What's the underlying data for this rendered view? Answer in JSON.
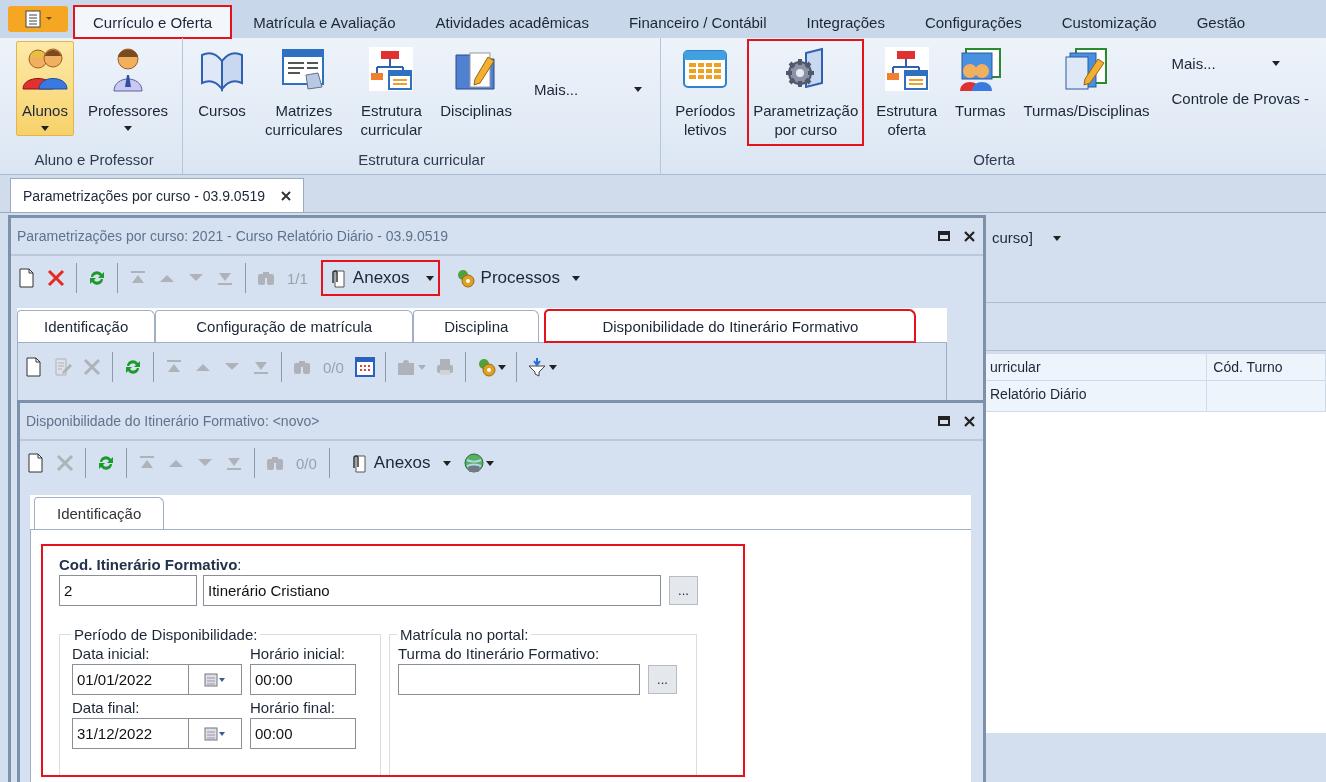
{
  "ribbon": {
    "tabs": [
      {
        "label": "Currículo e Oferta",
        "selected": true,
        "highlighted": true
      },
      {
        "label": "Matrícula e Avaliação",
        "selected": false,
        "highlighted": false
      },
      {
        "label": "Atividades acadêmicas",
        "selected": false,
        "highlighted": false
      },
      {
        "label": "Financeiro / Contábil",
        "selected": false,
        "highlighted": false
      },
      {
        "label": "Integrações",
        "selected": false,
        "highlighted": false
      },
      {
        "label": "Configurações",
        "selected": false,
        "highlighted": false
      },
      {
        "label": "Customização",
        "selected": false,
        "highlighted": false
      },
      {
        "label": "Gestão",
        "selected": false,
        "highlighted": false
      }
    ],
    "groups": [
      {
        "label": "Aluno e Professor",
        "items": [
          {
            "kind": "students",
            "label": "Alunos",
            "dropdown": true,
            "pressed": true,
            "highlighted": false
          },
          {
            "kind": "teachers",
            "label": "Professores",
            "dropdown": true,
            "pressed": false,
            "highlighted": false
          }
        ]
      },
      {
        "label": "Estrutura curricular",
        "items": [
          {
            "kind": "courses",
            "label": "Cursos",
            "dropdown": false,
            "pressed": false,
            "highlighted": false
          },
          {
            "kind": "matrices",
            "label": "Matrizes\ncurriculares",
            "dropdown": false,
            "pressed": false,
            "highlighted": false
          },
          {
            "kind": "structure",
            "label": "Estrutura\ncurricular",
            "dropdown": false,
            "pressed": false,
            "highlighted": false
          },
          {
            "kind": "subjects",
            "label": "Disciplinas",
            "dropdown": false,
            "pressed": false,
            "highlighted": false
          },
          {
            "kind": "column",
            "entries": [
              {
                "label": "Mais...",
                "dropdown": true
              }
            ]
          }
        ]
      },
      {
        "label": "Oferta",
        "items": [
          {
            "kind": "periods",
            "label": "Períodos\nletivos",
            "dropdown": false,
            "pressed": false,
            "highlighted": false
          },
          {
            "kind": "parameters",
            "label": "Parametrização\npor curso",
            "dropdown": false,
            "pressed": false,
            "highlighted": true
          },
          {
            "kind": "structure",
            "label": "Estrutura\noferta",
            "dropdown": false,
            "pressed": false,
            "highlighted": false
          },
          {
            "kind": "classes",
            "label": "Turmas",
            "dropdown": false,
            "pressed": false,
            "highlighted": false
          },
          {
            "kind": "class-subjects",
            "label": "Turmas/Disciplinas",
            "dropdown": false,
            "pressed": false,
            "highlighted": false
          },
          {
            "kind": "column",
            "entries": [
              {
                "label": "Mais...",
                "dropdown": true
              },
              {
                "label": "Controle de Provas -",
                "dropdown": false
              }
            ]
          }
        ]
      }
    ]
  },
  "document_tabs": [
    {
      "label": "Parametrizações por curso - 03.9.0519",
      "selected": true
    }
  ],
  "background": {
    "view_selector": "curso]",
    "columns": [
      "urricular",
      "Cód. Turno"
    ],
    "rows": [
      [
        "Relatório Diário"
      ]
    ]
  },
  "window": {
    "title": "Parametrizações por curso: 2021 - Curso Relatório Diário - 03.9.0519",
    "toolbar": [
      {
        "kind": "new",
        "disabled": false
      },
      {
        "kind": "delete",
        "disabled": false
      },
      {
        "kind": "separator"
      },
      {
        "kind": "refresh",
        "disabled": false
      },
      {
        "kind": "separator"
      },
      {
        "kind": "first",
        "disabled": true
      },
      {
        "kind": "previous",
        "disabled": true
      },
      {
        "kind": "next",
        "disabled": true
      },
      {
        "kind": "last",
        "disabled": true
      },
      {
        "kind": "separator"
      },
      {
        "kind": "find",
        "disabled": true
      },
      {
        "kind": "counter",
        "text": "1/1",
        "disabled": true
      },
      {
        "kind": "attachments",
        "label": "Anexos",
        "highlighted": true
      },
      {
        "kind": "processes",
        "label": "Processos",
        "highlighted": false
      }
    ],
    "tabs": [
      {
        "label": "Identificação",
        "selected": false,
        "highlighted": false
      },
      {
        "label": "Configuração de matrícula",
        "selected": false,
        "highlighted": false
      },
      {
        "label": "Disciplina",
        "selected": false,
        "highlighted": false
      },
      {
        "label": "Disponibilidade do Itinerário Formativo",
        "selected": true,
        "highlighted": true
      }
    ],
    "tab_toolbar": [
      {
        "kind": "new",
        "disabled": false
      },
      {
        "kind": "edit",
        "disabled": true
      },
      {
        "kind": "delete",
        "disabled": true
      },
      {
        "kind": "separator"
      },
      {
        "kind": "refresh",
        "disabled": false
      },
      {
        "kind": "separator"
      },
      {
        "kind": "first",
        "disabled": true
      },
      {
        "kind": "previous",
        "disabled": true
      },
      {
        "kind": "next",
        "disabled": true
      },
      {
        "kind": "last",
        "disabled": true
      },
      {
        "kind": "separator"
      },
      {
        "kind": "find",
        "disabled": true
      },
      {
        "kind": "counter",
        "text": "0/0",
        "disabled": true
      },
      {
        "kind": "grid",
        "disabled": false
      },
      {
        "kind": "separator"
      },
      {
        "kind": "plugin",
        "disabled": true,
        "dropdown": true
      },
      {
        "kind": "print",
        "disabled": true
      },
      {
        "kind": "separator"
      },
      {
        "kind": "process",
        "disabled": false,
        "dropdown": true
      },
      {
        "kind": "separator"
      },
      {
        "kind": "filter",
        "disabled": false,
        "dropdown": true
      }
    ]
  },
  "dialog": {
    "title": "Disponibilidade do Itinerário Formativo: <novo>",
    "toolbar": [
      {
        "kind": "new",
        "disabled": false
      },
      {
        "kind": "delete",
        "disabled": true
      },
      {
        "kind": "separator"
      },
      {
        "kind": "refresh",
        "disabled": false
      },
      {
        "kind": "separator"
      },
      {
        "kind": "first",
        "disabled": true
      },
      {
        "kind": "previous",
        "disabled": true
      },
      {
        "kind": "next",
        "disabled": true
      },
      {
        "kind": "last",
        "disabled": true
      },
      {
        "kind": "separator"
      },
      {
        "kind": "find",
        "disabled": true
      },
      {
        "kind": "counter",
        "text": "0/0",
        "disabled": true
      },
      {
        "kind": "separator"
      },
      {
        "kind": "attachments",
        "label": "Anexos",
        "highlighted": false
      },
      {
        "kind": "web",
        "disabled": false,
        "dropdown": true
      }
    ],
    "tabs": [
      {
        "label": "Identificação",
        "selected": true
      }
    ],
    "form": {
      "highlighted": true,
      "code_label": "**Cod. Itinerário Formativo**:",
      "code": "2",
      "name": "Itinerário Cristiano",
      "lookup": "...",
      "period": {
        "legend": "Período de Disponibilidade:",
        "start_date_label": "Data inicial:",
        "start_date": "01/01/2022",
        "start_time_label": "Horário inicial:",
        "start_time": "00:00",
        "end_date_label": "Data final:",
        "end_date": "31/12/2022",
        "end_time_label": "Horário final:",
        "end_time": "00:00"
      },
      "portal": {
        "legend": "Matrícula no portal:",
        "class_label": "Turma do Itinerário Formativo:",
        "lookup": "..."
      }
    }
  }
}
